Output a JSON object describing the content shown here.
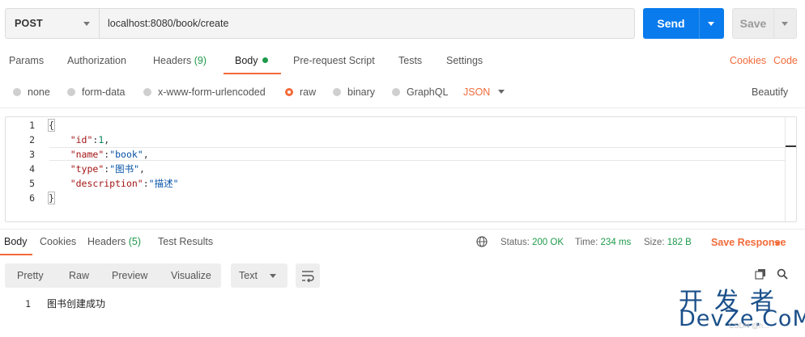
{
  "request": {
    "method": "POST",
    "url": "localhost:8080/book/create",
    "send_label": "Send",
    "save_label": "Save"
  },
  "request_tabs": {
    "params": "Params",
    "authorization": "Authorization",
    "headers": "Headers",
    "headers_count": "(9)",
    "body": "Body",
    "prerequest": "Pre-request Script",
    "tests": "Tests",
    "settings": "Settings",
    "cookies": "Cookies",
    "code": "Code",
    "active": "Body"
  },
  "body_types": {
    "none": "none",
    "form_data": "form-data",
    "urlencoded": "x-www-form-urlencoded",
    "raw": "raw",
    "binary": "binary",
    "graphql": "GraphQL",
    "format": "JSON",
    "beautify": "Beautify",
    "selected": "raw"
  },
  "editor": {
    "line_numbers": [
      "1",
      "2",
      "3",
      "4",
      "5",
      "6"
    ],
    "lines": {
      "l1": "{",
      "l2_key": "\"id\"",
      "l2_val": "1",
      "l3_key": "\"name\"",
      "l3_val": "\"book\"",
      "l4_key": "\"type\"",
      "l4_val": "\"图书\"",
      "l5_key": "\"description\"",
      "l5_val": "\"描述\"",
      "l6": "}"
    }
  },
  "response_tabs": {
    "body": "Body",
    "cookies": "Cookies",
    "headers": "Headers",
    "headers_count": "(5)",
    "test_results": "Test Results",
    "active": "Body"
  },
  "response_status": {
    "status_label": "Status:",
    "status_value": "200 OK",
    "time_label": "Time:",
    "time_value": "234 ms",
    "size_label": "Size:",
    "size_value": "182 B",
    "save_response": "Save Response"
  },
  "response_view": {
    "pretty": "Pretty",
    "raw": "Raw",
    "preview": "Preview",
    "visualize": "Visualize",
    "format": "Text"
  },
  "response_body": {
    "line_number": "1",
    "content": "图书创建成功"
  },
  "watermark": {
    "line1": "开发者",
    "line2": "DevZe.CoM",
    "line3": "CSDN @h..."
  },
  "colors": {
    "accent": "#f26b3a",
    "send": "#097bed",
    "success": "#1e9a4a"
  }
}
